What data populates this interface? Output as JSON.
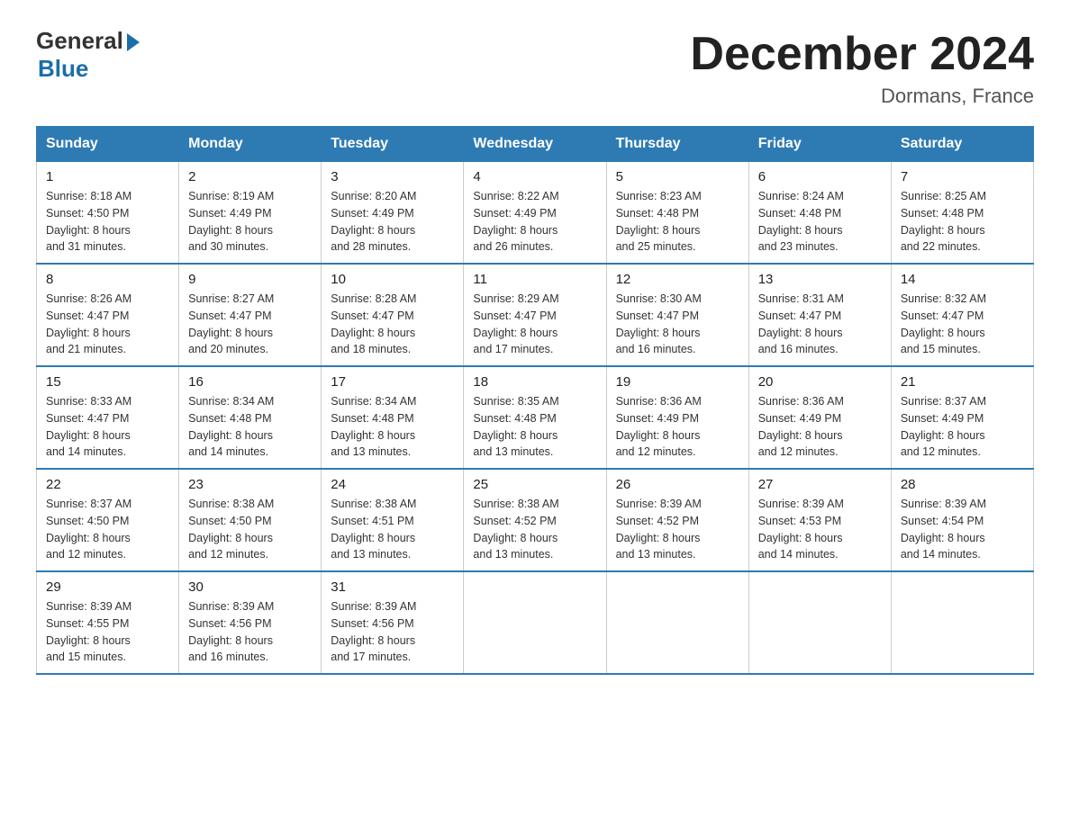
{
  "header": {
    "logo_general": "General",
    "logo_blue": "Blue",
    "title": "December 2024",
    "location": "Dormans, France"
  },
  "days_of_week": [
    "Sunday",
    "Monday",
    "Tuesday",
    "Wednesday",
    "Thursday",
    "Friday",
    "Saturday"
  ],
  "weeks": [
    [
      {
        "day": "1",
        "sunrise": "8:18 AM",
        "sunset": "4:50 PM",
        "daylight": "8 hours and 31 minutes."
      },
      {
        "day": "2",
        "sunrise": "8:19 AM",
        "sunset": "4:49 PM",
        "daylight": "8 hours and 30 minutes."
      },
      {
        "day": "3",
        "sunrise": "8:20 AM",
        "sunset": "4:49 PM",
        "daylight": "8 hours and 28 minutes."
      },
      {
        "day": "4",
        "sunrise": "8:22 AM",
        "sunset": "4:49 PM",
        "daylight": "8 hours and 26 minutes."
      },
      {
        "day": "5",
        "sunrise": "8:23 AM",
        "sunset": "4:48 PM",
        "daylight": "8 hours and 25 minutes."
      },
      {
        "day": "6",
        "sunrise": "8:24 AM",
        "sunset": "4:48 PM",
        "daylight": "8 hours and 23 minutes."
      },
      {
        "day": "7",
        "sunrise": "8:25 AM",
        "sunset": "4:48 PM",
        "daylight": "8 hours and 22 minutes."
      }
    ],
    [
      {
        "day": "8",
        "sunrise": "8:26 AM",
        "sunset": "4:47 PM",
        "daylight": "8 hours and 21 minutes."
      },
      {
        "day": "9",
        "sunrise": "8:27 AM",
        "sunset": "4:47 PM",
        "daylight": "8 hours and 20 minutes."
      },
      {
        "day": "10",
        "sunrise": "8:28 AM",
        "sunset": "4:47 PM",
        "daylight": "8 hours and 18 minutes."
      },
      {
        "day": "11",
        "sunrise": "8:29 AM",
        "sunset": "4:47 PM",
        "daylight": "8 hours and 17 minutes."
      },
      {
        "day": "12",
        "sunrise": "8:30 AM",
        "sunset": "4:47 PM",
        "daylight": "8 hours and 16 minutes."
      },
      {
        "day": "13",
        "sunrise": "8:31 AM",
        "sunset": "4:47 PM",
        "daylight": "8 hours and 16 minutes."
      },
      {
        "day": "14",
        "sunrise": "8:32 AM",
        "sunset": "4:47 PM",
        "daylight": "8 hours and 15 minutes."
      }
    ],
    [
      {
        "day": "15",
        "sunrise": "8:33 AM",
        "sunset": "4:47 PM",
        "daylight": "8 hours and 14 minutes."
      },
      {
        "day": "16",
        "sunrise": "8:34 AM",
        "sunset": "4:48 PM",
        "daylight": "8 hours and 14 minutes."
      },
      {
        "day": "17",
        "sunrise": "8:34 AM",
        "sunset": "4:48 PM",
        "daylight": "8 hours and 13 minutes."
      },
      {
        "day": "18",
        "sunrise": "8:35 AM",
        "sunset": "4:48 PM",
        "daylight": "8 hours and 13 minutes."
      },
      {
        "day": "19",
        "sunrise": "8:36 AM",
        "sunset": "4:49 PM",
        "daylight": "8 hours and 12 minutes."
      },
      {
        "day": "20",
        "sunrise": "8:36 AM",
        "sunset": "4:49 PM",
        "daylight": "8 hours and 12 minutes."
      },
      {
        "day": "21",
        "sunrise": "8:37 AM",
        "sunset": "4:49 PM",
        "daylight": "8 hours and 12 minutes."
      }
    ],
    [
      {
        "day": "22",
        "sunrise": "8:37 AM",
        "sunset": "4:50 PM",
        "daylight": "8 hours and 12 minutes."
      },
      {
        "day": "23",
        "sunrise": "8:38 AM",
        "sunset": "4:50 PM",
        "daylight": "8 hours and 12 minutes."
      },
      {
        "day": "24",
        "sunrise": "8:38 AM",
        "sunset": "4:51 PM",
        "daylight": "8 hours and 13 minutes."
      },
      {
        "day": "25",
        "sunrise": "8:38 AM",
        "sunset": "4:52 PM",
        "daylight": "8 hours and 13 minutes."
      },
      {
        "day": "26",
        "sunrise": "8:39 AM",
        "sunset": "4:52 PM",
        "daylight": "8 hours and 13 minutes."
      },
      {
        "day": "27",
        "sunrise": "8:39 AM",
        "sunset": "4:53 PM",
        "daylight": "8 hours and 14 minutes."
      },
      {
        "day": "28",
        "sunrise": "8:39 AM",
        "sunset": "4:54 PM",
        "daylight": "8 hours and 14 minutes."
      }
    ],
    [
      {
        "day": "29",
        "sunrise": "8:39 AM",
        "sunset": "4:55 PM",
        "daylight": "8 hours and 15 minutes."
      },
      {
        "day": "30",
        "sunrise": "8:39 AM",
        "sunset": "4:56 PM",
        "daylight": "8 hours and 16 minutes."
      },
      {
        "day": "31",
        "sunrise": "8:39 AM",
        "sunset": "4:56 PM",
        "daylight": "8 hours and 17 minutes."
      },
      null,
      null,
      null,
      null
    ]
  ],
  "labels": {
    "sunrise": "Sunrise:",
    "sunset": "Sunset:",
    "daylight": "Daylight:"
  }
}
